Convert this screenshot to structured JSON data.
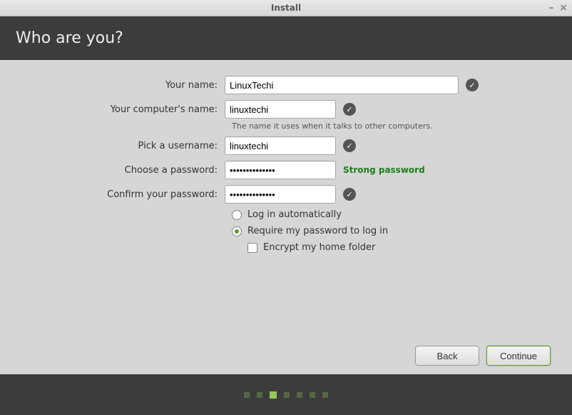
{
  "window": {
    "title": "Install"
  },
  "header": {
    "title": "Who are you?"
  },
  "form": {
    "name_label": "Your name:",
    "name_value": "LinuxTechi",
    "computer_label": "Your computer's name:",
    "computer_value": "linuxtechi",
    "computer_hint": "The name it uses when it talks to other computers.",
    "username_label": "Pick a username:",
    "username_value": "linuxtechi",
    "password_label": "Choose a password:",
    "password_value": "••••••••••••••",
    "password_strength": "Strong password",
    "confirm_label": "Confirm your password:",
    "confirm_value": "••••••••••••••"
  },
  "options": {
    "auto_login": "Log in automatically",
    "require_password": "Require my password to log in",
    "encrypt_home": "Encrypt my home folder",
    "selected": "require_password",
    "encrypt_checked": false
  },
  "buttons": {
    "back": "Back",
    "continue": "Continue"
  },
  "progress": {
    "total": 7,
    "active": 2
  }
}
